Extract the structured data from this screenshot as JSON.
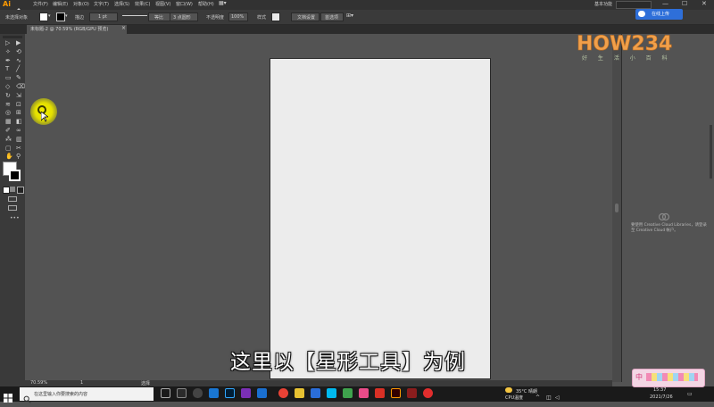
{
  "app": {
    "logo": "Ai",
    "menu": [
      "文件(F)",
      "编辑(E)",
      "对象(O)",
      "文字(T)",
      "选择(S)",
      "效果(C)",
      "视图(V)",
      "窗口(W)",
      "帮助(H)"
    ],
    "workspace": "基本功能",
    "window_controls": [
      "—",
      "☐",
      "✕"
    ],
    "cloud_button": "在线上传"
  },
  "control_bar": {
    "selection_label": "未选择对象",
    "stroke_label": "描边",
    "stroke_value": "1 pt",
    "brush_label": "等比",
    "points_label": "3 点圆形",
    "opacity_label": "不透明度",
    "opacity_value": "100%",
    "style_label": "样式",
    "doc_setup": "文档设置",
    "prefs": "首选项"
  },
  "document": {
    "tab_label": "未标题-2 @ 70.59% (RGB/GPU 预览)",
    "tab_close": "×"
  },
  "canvas": {
    "subtitle": "这里以【星形工具】为例"
  },
  "libraries_panel": {
    "message": "要使用 Creative Cloud Libraries，请登录至 Creative Cloud 帐户。"
  },
  "status_bar": {
    "zoom": "70.59%",
    "artboard_nav": "1",
    "tool": "选择"
  },
  "taskbar": {
    "search_placeholder": "在这里输入你要搜索的内容",
    "weather": "35°C 晴朗",
    "cpu_label": "CPU温度",
    "time": "15:37",
    "date": "2021/7/26",
    "ime_label": "中"
  },
  "watermark": {
    "brand": "HOW234",
    "slogan": "好 生 活 小 百 科"
  },
  "colors": {
    "accent_ai": "#ff9a00",
    "cloud_button": "#2e6fd9",
    "cursor_highlight": "#f5f000",
    "canvas_bg": "#535353",
    "artboard": "#ececec"
  }
}
